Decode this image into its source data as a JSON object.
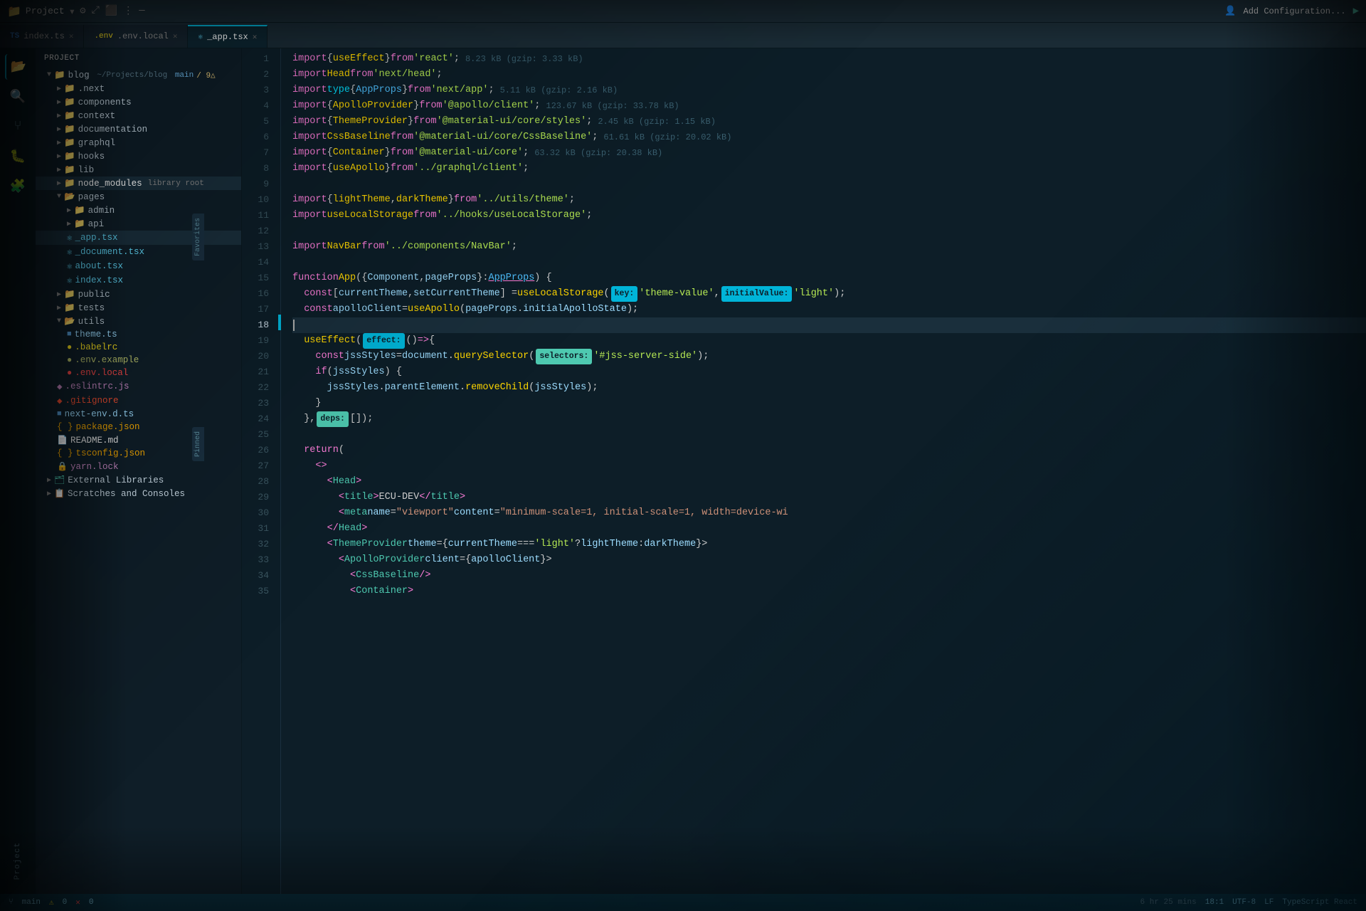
{
  "titleBar": {
    "project": "Project",
    "dropdownIcon": "▾",
    "addConfig": "Add Configuration...",
    "runIcon": "▶"
  },
  "tabs": [
    {
      "id": "index-ts",
      "label": "index.ts",
      "type": "ts",
      "active": false,
      "modified": false
    },
    {
      "id": "env-local",
      "label": ".env.local",
      "type": "env",
      "active": false,
      "modified": false
    },
    {
      "id": "app-tsx",
      "label": "_app.tsx",
      "type": "tsx",
      "active": true,
      "modified": false
    }
  ],
  "sidebar": {
    "header": "Project",
    "tree": [
      {
        "indent": 1,
        "type": "folder-open",
        "name": "blog",
        "extra": "~/Projects/blog",
        "branch": "main",
        "changes": "9△"
      },
      {
        "indent": 2,
        "type": "folder",
        "name": ".next"
      },
      {
        "indent": 2,
        "type": "folder",
        "name": "components"
      },
      {
        "indent": 2,
        "type": "folder",
        "name": "context"
      },
      {
        "indent": 2,
        "type": "folder",
        "name": "documentation"
      },
      {
        "indent": 2,
        "type": "folder",
        "name": "graphql"
      },
      {
        "indent": 2,
        "type": "folder",
        "name": "hooks"
      },
      {
        "indent": 2,
        "type": "folder",
        "name": "lib"
      },
      {
        "indent": 2,
        "type": "folder-special",
        "name": "node_modules",
        "badge": "library root"
      },
      {
        "indent": 2,
        "type": "folder-open",
        "name": "pages"
      },
      {
        "indent": 3,
        "type": "folder",
        "name": "admin"
      },
      {
        "indent": 3,
        "type": "folder",
        "name": "api"
      },
      {
        "indent": 3,
        "type": "file-tsx",
        "name": "_app.tsx"
      },
      {
        "indent": 3,
        "type": "file-tsx",
        "name": "_document.tsx"
      },
      {
        "indent": 3,
        "type": "file-tsx",
        "name": "about.tsx"
      },
      {
        "indent": 3,
        "type": "file-tsx",
        "name": "index.tsx"
      },
      {
        "indent": 2,
        "type": "folder",
        "name": "public"
      },
      {
        "indent": 2,
        "type": "folder",
        "name": "tests"
      },
      {
        "indent": 2,
        "type": "folder-open",
        "name": "utils"
      },
      {
        "indent": 3,
        "type": "file-ts",
        "name": "theme.ts"
      },
      {
        "indent": 3,
        "type": "file-babel",
        "name": ".babelrc"
      },
      {
        "indent": 3,
        "type": "file-env",
        "name": ".env.example"
      },
      {
        "indent": 3,
        "type": "file-env-red",
        "name": ".env.local"
      },
      {
        "indent": 2,
        "type": "file-eslint",
        "name": ".eslintrc.js"
      },
      {
        "indent": 2,
        "type": "file-git",
        "name": ".gitignore"
      },
      {
        "indent": 2,
        "type": "file-ts2",
        "name": "next-env.d.ts"
      },
      {
        "indent": 2,
        "type": "file-json",
        "name": "package.json"
      },
      {
        "indent": 2,
        "type": "file-md",
        "name": "README.md"
      },
      {
        "indent": 2,
        "type": "file-json2",
        "name": "tsconfig.json"
      },
      {
        "indent": 2,
        "type": "file-yarn",
        "name": "yarn.lock"
      },
      {
        "indent": 1,
        "type": "folder-external",
        "name": "External Libraries"
      },
      {
        "indent": 1,
        "type": "folder-scratches",
        "name": "Scratches and Consoles"
      }
    ]
  },
  "editor": {
    "filename": "_app.tsx",
    "lines": [
      {
        "num": 1,
        "code": "import { useEffect } from 'react';",
        "sizeInfo": "8.23 kB (gzip: 3.33 kB)"
      },
      {
        "num": 2,
        "code": "import Head from 'next/head';"
      },
      {
        "num": 3,
        "code": "import type { AppProps } from 'next/app';",
        "sizeInfo": "5.11 kB (gzip: 2.16 kB)"
      },
      {
        "num": 4,
        "code": "import { ApolloProvider } from '@apollo/client';",
        "sizeInfo": "123.67 kB (gzip: 33.78 kB)"
      },
      {
        "num": 5,
        "code": "import { ThemeProvider } from '@material-ui/core/styles';",
        "sizeInfo": "2.45 kB (gzip: 1.15 kB)"
      },
      {
        "num": 6,
        "code": "import CssBaseline from '@material-ui/core/CssBaseline';",
        "sizeInfo": "61.61 kB (gzip: 20.02 kB)"
      },
      {
        "num": 7,
        "code": "import { Container } from '@material-ui/core';",
        "sizeInfo": "63.32 kB (gzip: 20.38 kB)"
      },
      {
        "num": 8,
        "code": "import { useApollo } from '../graphql/client';"
      },
      {
        "num": 9,
        "code": ""
      },
      {
        "num": 10,
        "code": "import { lightTheme, darkTheme } from '../utils/theme';"
      },
      {
        "num": 11,
        "code": "import useLocalStorage from '../hooks/useLocalStorage';"
      },
      {
        "num": 12,
        "code": ""
      },
      {
        "num": 13,
        "code": "import NavBar from '../components/NavBar';"
      },
      {
        "num": 14,
        "code": ""
      },
      {
        "num": 15,
        "code": "function App({ Component, pageProps }: AppProps) {"
      },
      {
        "num": 16,
        "code": "  const [currentTheme, setCurrentTheme] = useLocalStorage( key: 'theme-value',  initialValue: 'light');"
      },
      {
        "num": 17,
        "code": "  const apolloClient = useApollo(pageProps.initialApolloState);"
      },
      {
        "num": 18,
        "code": "",
        "active": true
      },
      {
        "num": 19,
        "code": "  useEffect( effect: () => {"
      },
      {
        "num": 20,
        "code": "    const jssStyles = document.querySelector( selectors: '#jss-server-side');"
      },
      {
        "num": 21,
        "code": "    if (jssStyles) {"
      },
      {
        "num": 22,
        "code": "      jssStyles.parentElement.removeChild(jssStyles);"
      },
      {
        "num": 23,
        "code": "    }"
      },
      {
        "num": 24,
        "code": "  },  deps: []);"
      },
      {
        "num": 25,
        "code": ""
      },
      {
        "num": 26,
        "code": "  return ("
      },
      {
        "num": 27,
        "code": "    <>"
      },
      {
        "num": 28,
        "code": "      <Head>"
      },
      {
        "num": 29,
        "code": "        <title>ECU-DEV</title>"
      },
      {
        "num": 30,
        "code": "        <meta name=\"viewport\" content=\"minimum-scale=1, initial-scale=1, width=device-wi"
      },
      {
        "num": 31,
        "code": "      </Head>"
      },
      {
        "num": 32,
        "code": "      <ThemeProvider theme={currentTheme === 'light' ? lightTheme : darkTheme}>"
      },
      {
        "num": 33,
        "code": "        <ApolloProvider client={apolloClient}>"
      },
      {
        "num": 34,
        "code": "          <CssBaseline />"
      },
      {
        "num": 35,
        "code": "          <Container"
      }
    ]
  },
  "statusBar": {
    "branch": "main",
    "warnings": "0",
    "errors": "0",
    "lineCol": "18:1",
    "encoding": "UTF-8",
    "lineEnding": "LF",
    "language": "TypeScript React",
    "timeInfo": "6 hr 25 mins"
  }
}
